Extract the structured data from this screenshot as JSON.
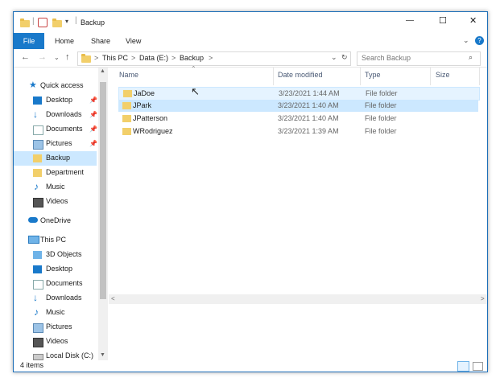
{
  "window": {
    "title": "Backup",
    "controls": {
      "minimize": "—",
      "maximize": "☐",
      "close": "✕"
    }
  },
  "ribbon": {
    "file": "File",
    "tabs": [
      "Home",
      "Share",
      "View"
    ],
    "help": "?"
  },
  "address": {
    "crumbs": [
      "This PC",
      "Data (E:)",
      "Backup"
    ],
    "separator": ">",
    "search_placeholder": "Search Backup"
  },
  "nav": {
    "quick_access": "Quick access",
    "items": [
      {
        "label": "Desktop",
        "pinned": true
      },
      {
        "label": "Downloads",
        "pinned": true
      },
      {
        "label": "Documents",
        "pinned": true
      },
      {
        "label": "Pictures",
        "pinned": true
      },
      {
        "label": "Backup",
        "pinned": false
      },
      {
        "label": "Department",
        "pinned": false
      },
      {
        "label": "Music",
        "pinned": false
      },
      {
        "label": "Videos",
        "pinned": false
      }
    ],
    "onedrive": "OneDrive",
    "this_pc": "This PC",
    "pc_items": [
      "3D Objects",
      "Desktop",
      "Documents",
      "Downloads",
      "Music",
      "Pictures",
      "Videos",
      "Local Disk (C:)"
    ]
  },
  "columns": [
    "Name",
    "Date modified",
    "Type",
    "Size"
  ],
  "files": [
    {
      "name": "JaDoe",
      "date": "3/23/2021 1:44 AM",
      "type": "File folder"
    },
    {
      "name": "JPark",
      "date": "3/23/2021 1:40 AM",
      "type": "File folder"
    },
    {
      "name": "JPatterson",
      "date": "3/23/2021 1:40 AM",
      "type": "File folder"
    },
    {
      "name": "WRodriguez",
      "date": "3/23/2021 1:39 AM",
      "type": "File folder"
    }
  ],
  "status": {
    "count": "4 items"
  },
  "colors": {
    "accent": "#1979ca",
    "selection": "#cce8ff",
    "folder": "#f2cf6a"
  }
}
